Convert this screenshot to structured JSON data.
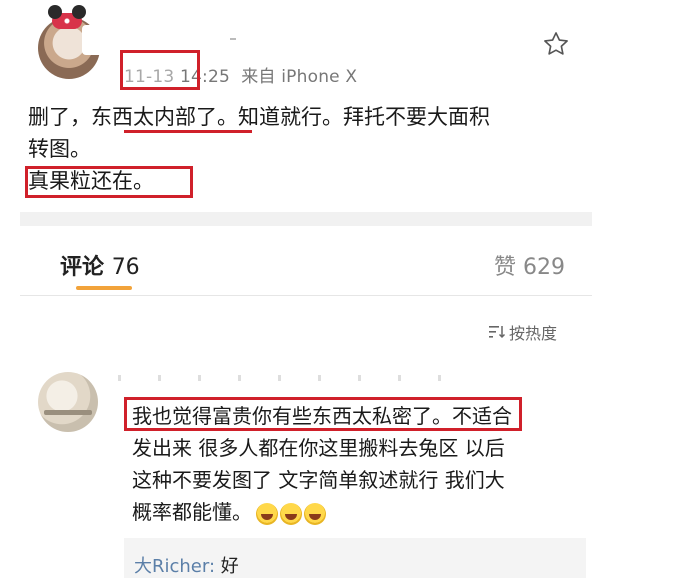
{
  "post": {
    "date": "11-13",
    "time": " 14:25",
    "source": "来自 iPhone X",
    "text_line1_pre": "删了，",
    "text_line1_hl": "东西太内部",
    "text_line1_post": "了。知道就行。拜托不要大面积",
    "text_line2": "转图。",
    "text_line3": "真果粒还在。"
  },
  "tabs": {
    "comments_label": "评论",
    "comments_count": "76",
    "likes_label": "赞",
    "likes_count": "629"
  },
  "sort": {
    "label": "按热度"
  },
  "comment": {
    "highlight": "我也觉得富贵你有些东西太私密了。",
    "rest1": "不适合",
    "line2": "发出来 很多人都在你这里搬料去兔区 以后",
    "line3": "这种不要发图了 文字简单叙述就行 我们大",
    "line4": "概率都能懂。"
  },
  "reply": {
    "author": "大Richer:",
    "text": " 好"
  },
  "colors": {
    "annotation": "#d0202a",
    "tab_indicator": "#f2a33a",
    "reply_name": "#5b7fa8"
  }
}
